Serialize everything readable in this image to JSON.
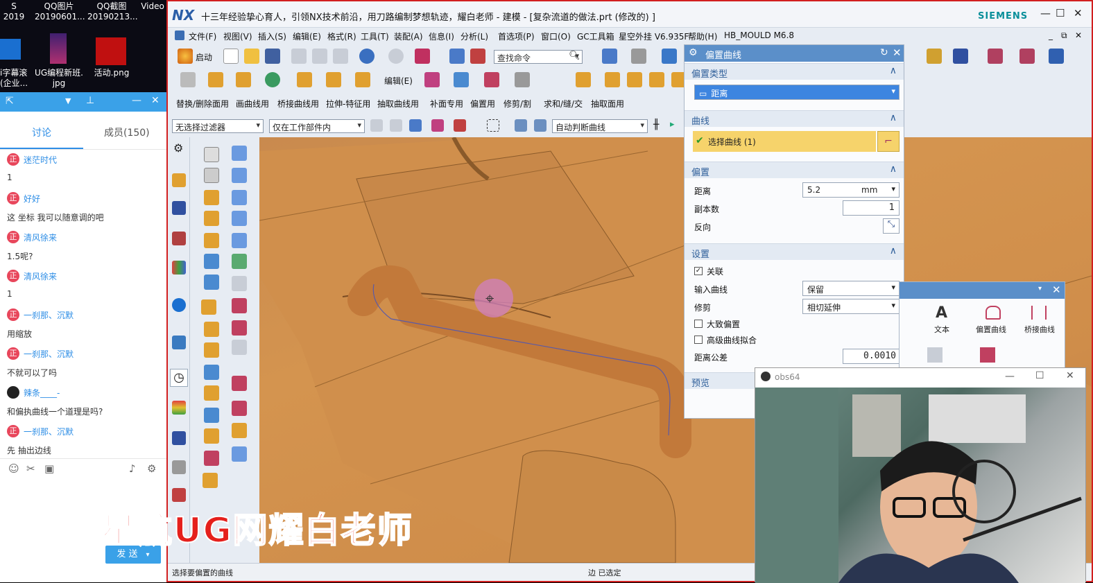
{
  "desktop": {
    "icons": [
      {
        "label": "S 2019"
      },
      {
        "label": "QQ图片\n20190601..."
      },
      {
        "label": "QQ截图\n20190213..."
      },
      {
        "label": "Video"
      },
      {
        "label": "i字幕滚\n(企业..."
      },
      {
        "label": "UG编程新班.\njpg"
      },
      {
        "label": "活动.png"
      }
    ]
  },
  "qq": {
    "tabs": [
      "讨论",
      "成员(150)"
    ],
    "messages": [
      {
        "name": "迷茫时代",
        "avatar": "正",
        "text": "1"
      },
      {
        "name": "好好",
        "avatar": "正",
        "text": "这 坐标  我可以随意调的吧"
      },
      {
        "name": "清风徐来",
        "avatar": "正",
        "text": "1.5呢?"
      },
      {
        "name": "清风徐来",
        "avatar": "正",
        "text": "1"
      },
      {
        "name": "一刹那、沉默",
        "avatar": "正",
        "text": "用缩放"
      },
      {
        "name": "一刹那、沉默",
        "avatar": "正",
        "text": "不就可以了吗"
      },
      {
        "name": "辣条____-",
        "avatar": "",
        "text": "和偏执曲线一个道理是吗?"
      },
      {
        "name": "一刹那、沉默",
        "avatar": "正",
        "text": "先 抽出边线"
      }
    ],
    "send_label": "发 送"
  },
  "watermark": "星航UG网耀白老师",
  "nx": {
    "logo": "NX",
    "title": "十三年经验挚心育人，引领NX技术前沿，用刀路编制梦想轨迹，耀白老师 - 建模 - [复杂流道的做法.prt  (修改的) ]",
    "brand": "SIEMENS",
    "menus": [
      "文件(F)",
      "视图(V)",
      "插入(S)",
      "编辑(E)",
      "格式(R)",
      "工具(T)",
      "装配(A)",
      "信息(I)",
      "分析(L)",
      "首选项(P)",
      "窗口(O)",
      "GC工具箱",
      "星空外挂 V6.935F",
      "帮助(H)",
      "HB_MOULD M6.8"
    ],
    "toolbar": {
      "start_label": "启动",
      "search_placeholder": "查找命令",
      "edit_label": "编辑(E)",
      "row3": [
        "替换/删除面用",
        "画曲线用",
        "桥接曲线用",
        "拉伸-特征用",
        "抽取曲线用",
        "补面专用",
        "偏置用",
        "修剪/割",
        "求和/缝/交",
        "抽取面用"
      ],
      "filter": "无选择过滤器",
      "scope": "仅在工作部件内",
      "curve_rule": "自动判断曲线"
    },
    "status_left": "选择要偏置的曲线",
    "status_mid": "边 已选定"
  },
  "dialog": {
    "title": "偏置曲线",
    "sections": {
      "type": "偏置类型",
      "curve": "曲线",
      "offset": "偏置",
      "settings": "设置",
      "preview": "预览"
    },
    "type_value": "距离",
    "select_curve": "选择曲线 (1)",
    "distance_label": "距离",
    "distance_value": "5.2",
    "distance_unit": "mm",
    "copies_label": "副本数",
    "copies_value": "1",
    "reverse_label": "反向",
    "assoc_label": "关联",
    "input_curve_label": "输入曲线",
    "input_curve_value": "保留",
    "trim_label": "修剪",
    "trim_value": "相切延伸",
    "rough_label": "大致偏置",
    "hq_label": "高级曲线拟合",
    "tolerance_label": "距离公差",
    "tolerance_value": "0.0010"
  },
  "panel2": {
    "items": [
      "文本",
      "偏置曲线",
      "桥接曲线"
    ]
  },
  "obs": {
    "title": "obs64"
  },
  "colors": {
    "accent": "#5b8fc9",
    "highlight": "#f6d36b",
    "border_red": "#d21f1f",
    "model": "#d4944f"
  }
}
